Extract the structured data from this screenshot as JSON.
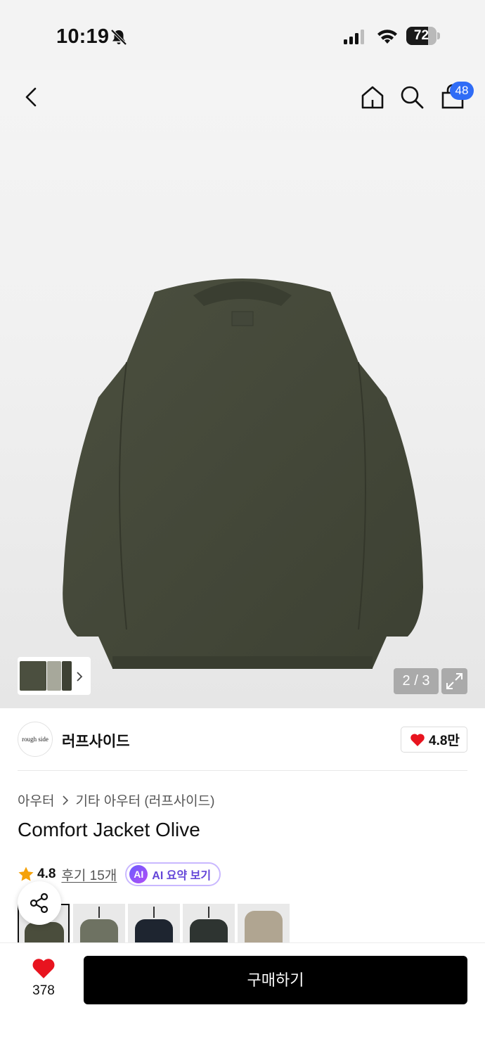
{
  "status_bar": {
    "time": "10:19",
    "battery_percent": 72,
    "battery_label": "72",
    "icons": [
      "bell-slash-icon",
      "signal-icon",
      "wifi-icon",
      "battery-icon"
    ]
  },
  "header": {
    "icons": [
      "back-icon",
      "home-icon",
      "search-icon",
      "shopping-bag-icon"
    ],
    "cart_count": "48"
  },
  "gallery": {
    "page_indicator": "2 / 3",
    "current_page": 2,
    "total_pages": 3,
    "expand_icon": "expand-icon",
    "thumb_next_icon": "chevron-right-icon"
  },
  "brand": {
    "logo_text": "rough side",
    "name": "러프사이드",
    "likes": "4.8만"
  },
  "breadcrumb": {
    "category": "아우터",
    "subcategory": "기타 아우터 (러프사이드)"
  },
  "product": {
    "title": "Comfort Jacket Olive",
    "rating": "4.8",
    "review_link": "후기 15개",
    "ai_badge": "AI",
    "ai_summary_label": "AI 요약 보기"
  },
  "color_options": [
    {
      "name": "olive",
      "color": "#4a4d3c"
    },
    {
      "name": "khaki",
      "color": "#6e7262"
    },
    {
      "name": "navy",
      "color": "#1e2530"
    },
    {
      "name": "charcoal",
      "color": "#2e3431"
    },
    {
      "name": "beige",
      "color": "#b0a591"
    }
  ],
  "bottom_bar": {
    "wish_count": "378",
    "buy_label": "구매하기"
  },
  "colors": {
    "accent_blue": "#2f6cf6",
    "heart_red": "#e8141f",
    "star_orange": "#f5a20a",
    "ai_purple": "#6446d8"
  }
}
